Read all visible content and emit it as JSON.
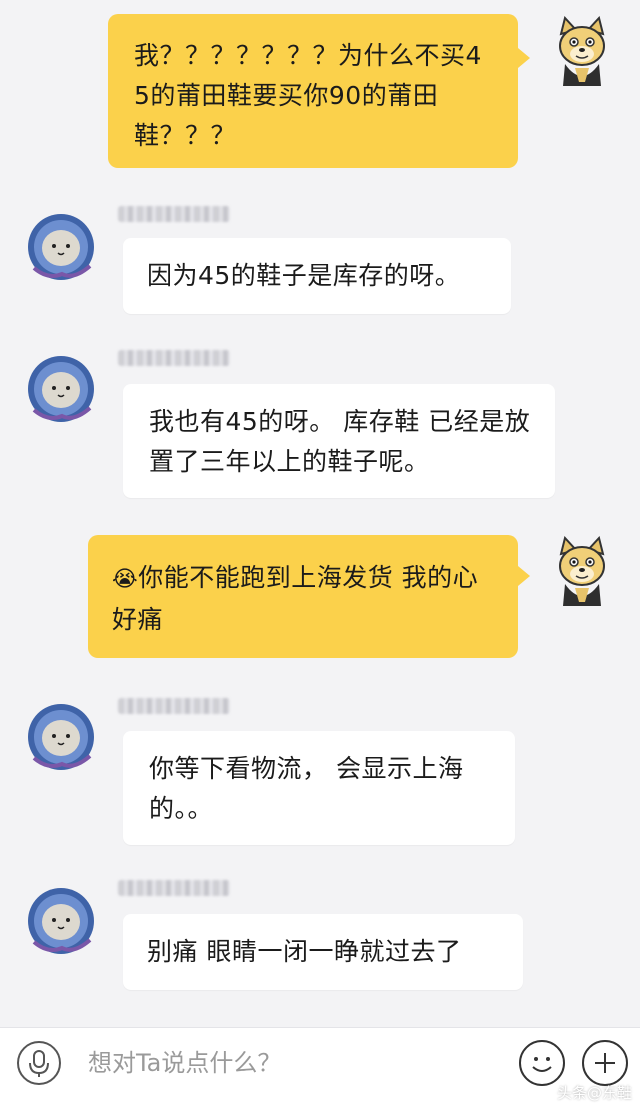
{
  "messages": [
    {
      "side": "out",
      "text": "我？？？？？？？为什么不买45的莆田鞋要买你90的莆田鞋？？？"
    },
    {
      "side": "in",
      "text": "因为45的鞋子是库存的呀。"
    },
    {
      "side": "in",
      "text": "我也有45的呀。 库存鞋 已经是放置了三年以上的鞋子呢。"
    },
    {
      "side": "out",
      "emoji": "😭",
      "text": "你能不能跑到上海发货 我的心好痛"
    },
    {
      "side": "in",
      "text": "你等下看物流， 会显示上海的。。"
    },
    {
      "side": "in",
      "text": "别痛 眼睛一闭一睁就过去了"
    }
  ],
  "input": {
    "placeholder": "想对Ta说点什么？",
    "mic_icon": "microphone-icon",
    "emoji_icon": "smiley-icon",
    "add_icon": "plus-icon"
  },
  "watermark": "头条@东鞋",
  "colors": {
    "outgoing_bubble": "#fbd14b",
    "incoming_bubble": "#ffffff",
    "background": "#f3f3f5"
  }
}
